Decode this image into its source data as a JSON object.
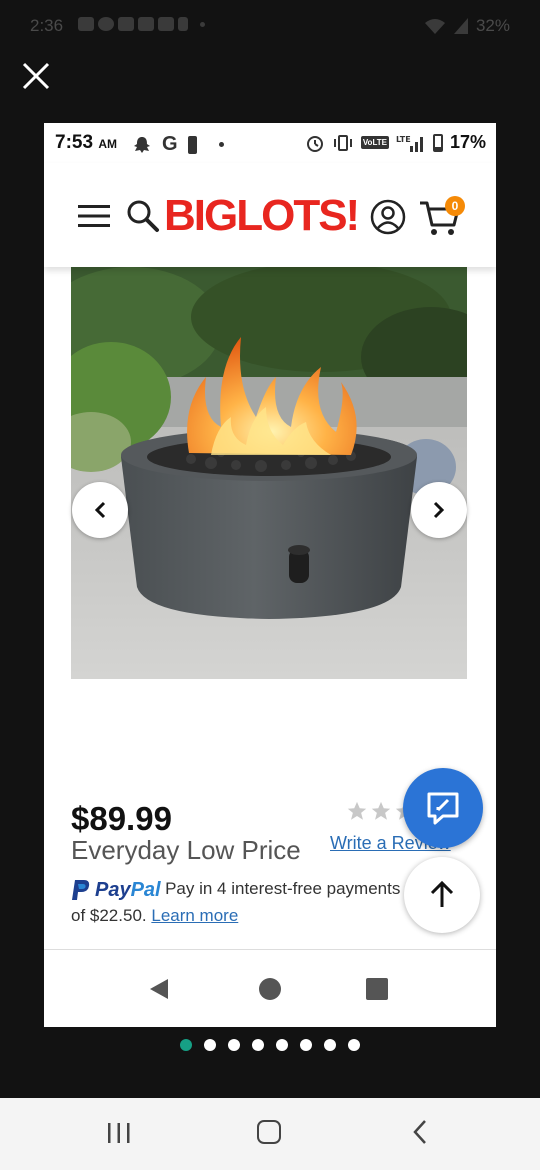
{
  "outer_status": {
    "time": "2:36",
    "battery": "32%"
  },
  "screenshot": {
    "status_bar": {
      "time": "7:53",
      "ampm": "AM",
      "battery": "17%"
    },
    "header": {
      "logo": "BIGLOTS!",
      "cart_count": "0"
    },
    "product": {
      "price": "$89.99",
      "price_label": "Everyday Low Price",
      "rating": 0,
      "rating_max": 5,
      "write_review": "Write a Review",
      "paypal": {
        "brand_pay": "Pay",
        "brand_pal": "Pal",
        "line1": "Pay in 4 interest-free payments",
        "line2": "of $22.50.",
        "learn_more": "Learn more"
      }
    }
  },
  "carousel": {
    "total": 8,
    "active": 1
  },
  "colors": {
    "brand_red": "#e8261f",
    "cart_badge": "#f58a07",
    "chat_button": "#2b74d6",
    "link": "#2a6db5",
    "dot_active": "#16a085"
  }
}
